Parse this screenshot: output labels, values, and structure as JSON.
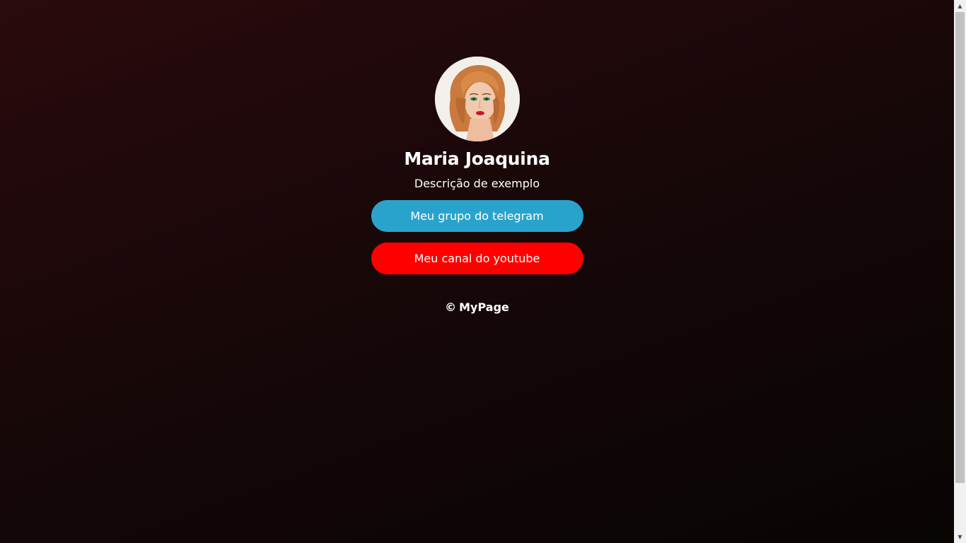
{
  "profile": {
    "name": "Maria Joaquina",
    "description": "Descrição de exemplo",
    "avatar_icon": "profile-photo"
  },
  "links": [
    {
      "label": "Meu grupo do telegram",
      "color": "#2aa3cc"
    },
    {
      "label": "Meu canal do youtube",
      "color": "#ff0000"
    }
  ],
  "footer": {
    "copyright_symbol": "©",
    "brand": "MyPage"
  },
  "scrollbar": {
    "up_arrow": "▲",
    "down_arrow": "▼"
  }
}
